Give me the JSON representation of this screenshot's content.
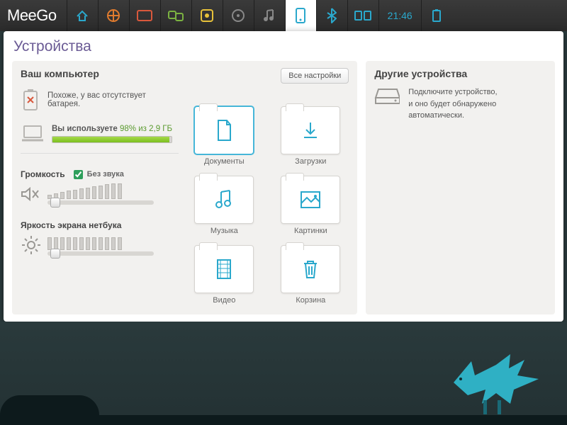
{
  "logo": "MeeGo",
  "clock": "21:46",
  "title": "Устройства",
  "left": {
    "title": "Ваш компьютер",
    "all_settings": "Все настройки",
    "battery_msg": "Похоже, у вас отсутствует батарея.",
    "usage_prefix": "Вы используете",
    "usage_pct": "98%",
    "usage_of": "из 2,9 ГБ",
    "disk_pct": 98,
    "volume_label": "Громкость",
    "mute_label": "Без звука",
    "brightness_label": "Яркость экрана нетбука"
  },
  "folders": [
    {
      "label": "Документы",
      "icon": "document",
      "selected": true
    },
    {
      "label": "Загрузки",
      "icon": "download"
    },
    {
      "label": "Музыка",
      "icon": "music"
    },
    {
      "label": "Картинки",
      "icon": "picture"
    },
    {
      "label": "Видео",
      "icon": "video"
    },
    {
      "label": "Корзина",
      "icon": "trash"
    }
  ],
  "right": {
    "title": "Другие устройства",
    "line1": "Подключите устройство,",
    "line2": "и оно будет обнаружено автоматически."
  }
}
